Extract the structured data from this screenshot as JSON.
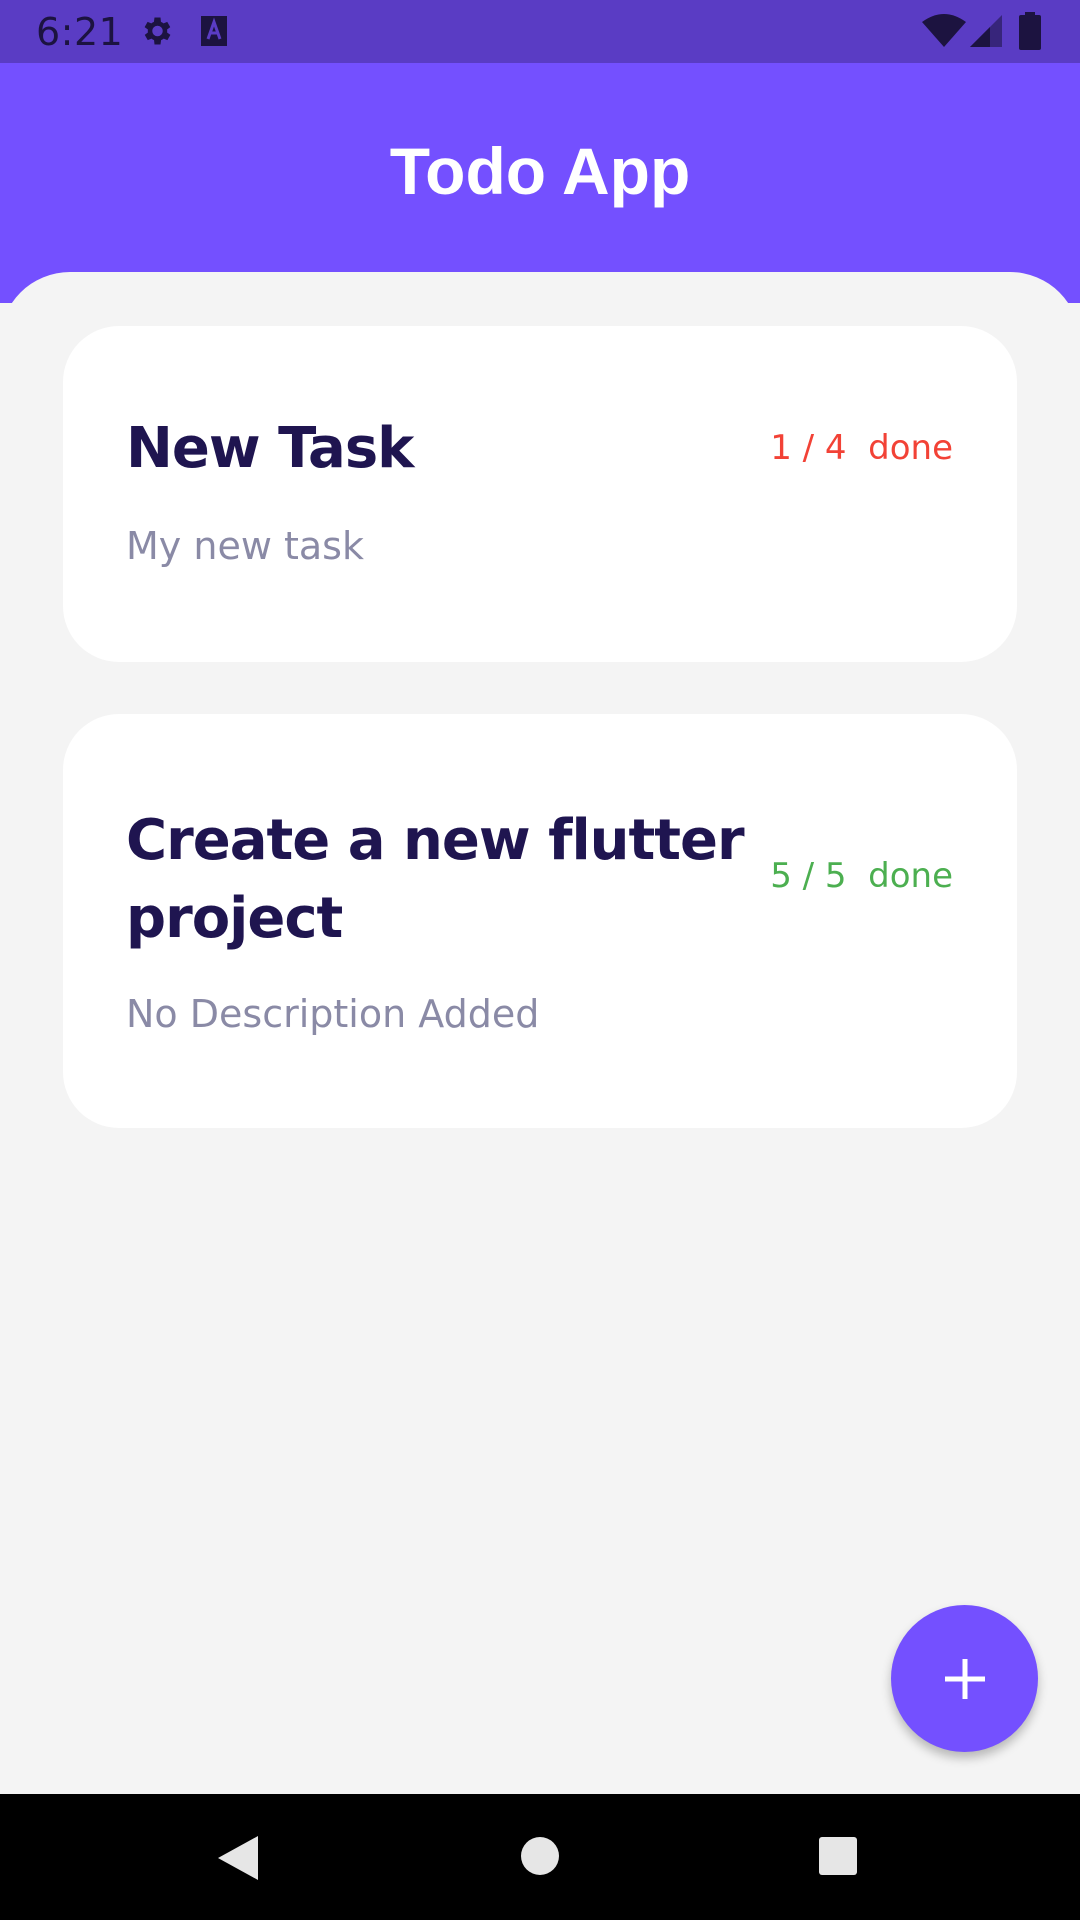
{
  "status_bar": {
    "time": "6:21",
    "icons": [
      "gear-icon",
      "a-icon",
      "wifi-icon",
      "signal-icon",
      "battery-icon"
    ]
  },
  "app_bar": {
    "title": "Todo App"
  },
  "tasks": [
    {
      "title": "New Task",
      "description": "My new task",
      "progress": "1 / 4  done",
      "progress_color": "#f24236"
    },
    {
      "title": "Create a new flutter project",
      "description": "No Description Added",
      "progress": "5 / 5  done",
      "progress_color": "#4caf50"
    }
  ],
  "fab": {
    "icon": "plus-icon"
  },
  "nav_bar": {
    "icons": [
      "back-icon",
      "home-icon",
      "recents-icon"
    ]
  },
  "colors": {
    "status_bar": "#5a3cc4",
    "accent": "#7450ff",
    "background": "#f4f4f4",
    "title_text": "#1f1550",
    "description_text": "#8a8aa6"
  }
}
